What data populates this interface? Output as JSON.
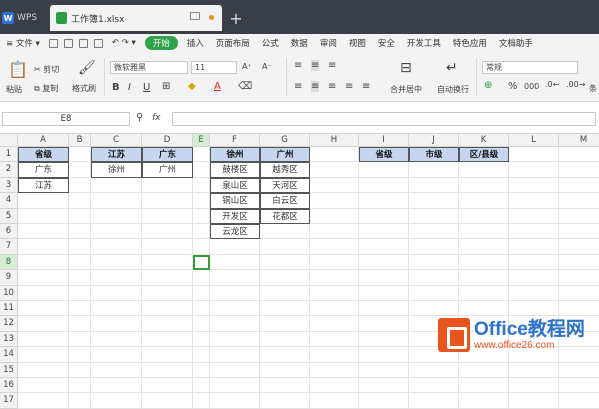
{
  "tabs": {
    "app": "WPS",
    "document": "工作簿1.xlsx",
    "add": "+"
  },
  "menu": {
    "file": "文件",
    "items": [
      "开始",
      "插入",
      "页面布局",
      "公式",
      "数据",
      "审阅",
      "视图",
      "安全",
      "开发工具",
      "特色应用",
      "文档助手"
    ]
  },
  "ribbon": {
    "paste": "粘贴",
    "cut": "剪切",
    "copy": "复制",
    "format_painter": "格式刷",
    "font": "微软雅黑",
    "size": "11",
    "merge": "合并居中",
    "wrap": "自动换行",
    "number_format": "常规",
    "percent": "%",
    "thousands": "000",
    "cond": "条",
    "bold": "B",
    "italic": "I",
    "underline": "U",
    "font_color": "A",
    "grow": "A⁺",
    "shrink": "A⁻"
  },
  "formula_bar": {
    "name_box": "E8",
    "fx": "fx"
  },
  "columns": [
    "A",
    "B",
    "C",
    "D",
    "E",
    "F",
    "G",
    "H",
    "I",
    "J",
    "K",
    "L",
    "M"
  ],
  "rows": [
    "1",
    "2",
    "3",
    "4",
    "5",
    "6",
    "7",
    "8",
    "9",
    "10",
    "11",
    "12",
    "13",
    "14",
    "15",
    "16",
    "17"
  ],
  "active_cell": "E8",
  "cells": {
    "A1": "省级",
    "A2": "广东",
    "A3": "江苏",
    "C1": "江苏",
    "C2": "徐州",
    "D1": "广东",
    "D2": "广州",
    "F1": "徐州",
    "F2": "鼓楼区",
    "F3": "泉山区",
    "F4": "铜山区",
    "F5": "开发区",
    "F6": "云龙区",
    "G1": "广州",
    "G2": "越秀区",
    "G3": "天河区",
    "G4": "白云区",
    "G5": "花都区",
    "I1": "省级",
    "J1": "市级",
    "K1": "区/县级"
  },
  "watermark": {
    "title": "Office教程网",
    "url": "www.office26.com"
  }
}
